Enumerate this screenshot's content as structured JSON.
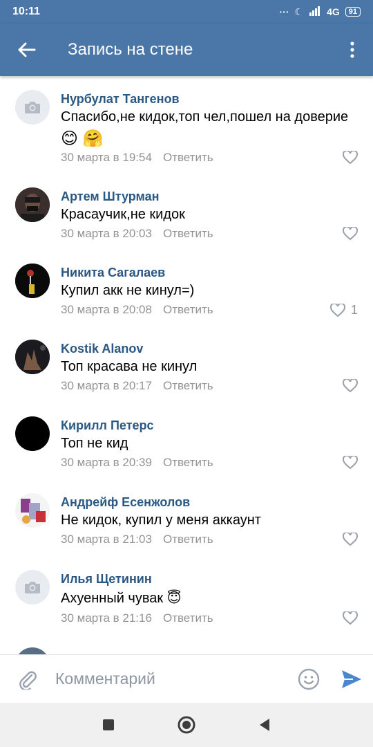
{
  "status_bar": {
    "time": "10:11",
    "signal": "...",
    "network": "4G",
    "battery": "91"
  },
  "app_bar": {
    "title": "Запись на стене"
  },
  "comments": [
    {
      "author": "Нурбулат Тангенов",
      "text": "Спасибо,не кидок,топ чел,пошел на доверие",
      "emoji": "😊 🤗",
      "date": "30 марта в 19:54",
      "reply_label": "Ответить",
      "likes": "",
      "avatar": "camera-placeholder"
    },
    {
      "author": "Артем Штурман",
      "text": "Красаучик,не кидок",
      "date": "30 марта в 20:03",
      "reply_label": "Ответить",
      "likes": "",
      "avatar": "photo"
    },
    {
      "author": "Никита Сагалаев",
      "text": "Купил акк не кинул=)",
      "date": "30 марта в 20:08",
      "reply_label": "Ответить",
      "likes": "1",
      "avatar": "photo"
    },
    {
      "author": "Kostik Alanov",
      "text": "Топ красава не кинул",
      "date": "30 марта в 20:17",
      "reply_label": "Ответить",
      "likes": "",
      "avatar": "photo"
    },
    {
      "author": "Кирилл Петерс",
      "text": "Топ не кид",
      "date": "30 марта в 20:39",
      "reply_label": "Ответить",
      "likes": "",
      "avatar": "black"
    },
    {
      "author": "Андрейф Есенжолов",
      "text": "Не кидок, купил у меня аккаунт",
      "date": "30 марта в 21:03",
      "reply_label": "Ответить",
      "likes": "",
      "avatar": "photo"
    },
    {
      "author": "Илья Щетинин",
      "text": "Ахуенный чувак 😇",
      "date": "30 марта в 21:16",
      "reply_label": "Ответить",
      "likes": "",
      "avatar": "camera-placeholder"
    }
  ],
  "composer": {
    "placeholder": "Комментарий"
  },
  "colors": {
    "header": "#4a76a8",
    "author": "#2a5885",
    "meta": "#939393",
    "send": "#4a86d0"
  }
}
